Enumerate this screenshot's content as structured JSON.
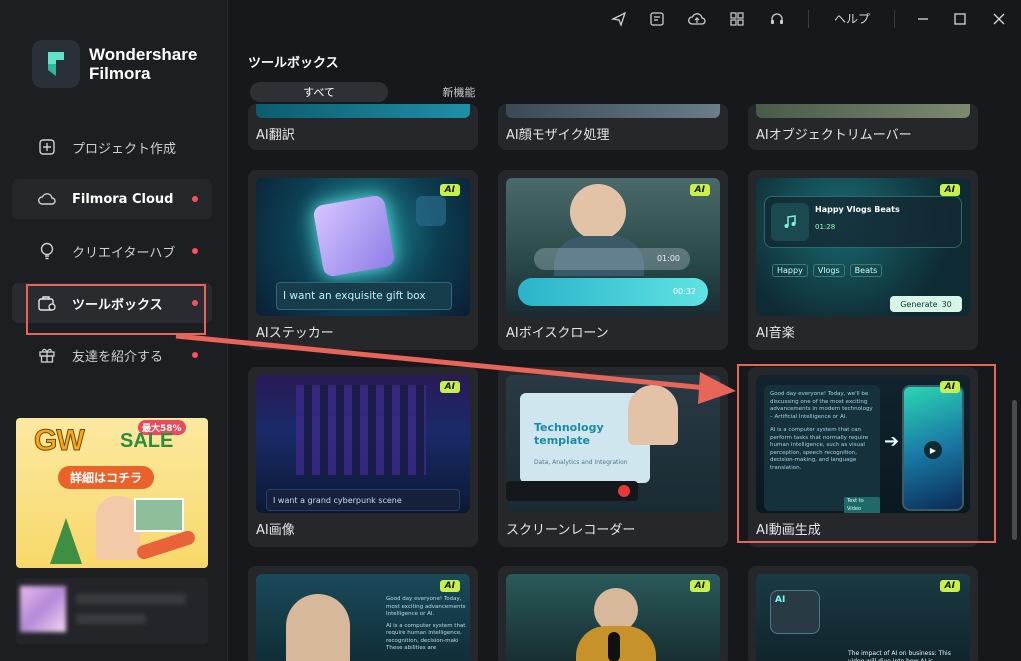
{
  "app": {
    "name_line1": "Wondershare",
    "name_line2": "Filmora"
  },
  "sidebar": {
    "items": [
      {
        "label": "プロジェクト作成",
        "icon": "new-project-icon"
      },
      {
        "label": "Filmora Cloud",
        "icon": "cloud-icon",
        "dot": true
      },
      {
        "label": "クリエイターハブ",
        "icon": "lightbulb-icon",
        "dot": true
      },
      {
        "label": "ツールボックス",
        "icon": "toolbox-icon",
        "dot": true
      },
      {
        "label": "友達を紹介する",
        "icon": "gift-icon",
        "dot": true
      }
    ],
    "banner": {
      "gw": "GW",
      "sale": "SALE",
      "discount": "最大58%",
      "cta": "詳細はコチラ"
    }
  },
  "topbar": {
    "icons": [
      "send-icon",
      "schedule-icon",
      "cloud-upload-icon",
      "grid-icon",
      "headset-icon"
    ],
    "help": "ヘルプ"
  },
  "main": {
    "title": "ツールボックス",
    "tabs": [
      {
        "label": "すべて"
      },
      {
        "label": "新機能"
      }
    ],
    "row0": [
      "AI翻訳",
      "AI顔モザイク処理",
      "AIオブジェクトリムーバー"
    ],
    "row1": [
      "AIステッカー",
      "AIボイスクローン",
      "AI音楽"
    ],
    "row2": [
      "AI画像",
      "スクリーンレコーダー",
      "AI動画生成"
    ],
    "thumbs": {
      "sticker_prompt": "I want an exquisite gift box",
      "voice_time1": "01:00",
      "voice_time2": "00:32",
      "music_title": "Happy Vlogs Beats",
      "music_time": "01:28",
      "music_tags": [
        "Happy",
        "Vlogs",
        "Beats"
      ],
      "music_button": "Generate",
      "music_count": "30",
      "image_prompt": "I want a grand cyberpunk scene",
      "recorder_title_1": "Technology",
      "recorder_title_2": "template",
      "recorder_sub": "Data, Analytics and Integration",
      "video_text_1": "Good day everyone! Today, we'll be discussing one of the most exciting advancements in modern technology – Artificial Intelligence or AI.",
      "video_text_2": "AI is a computer system that can perform tasks that normally require human intelligence, such as visual perception, speech recognition, decision-making, and language translation.",
      "video_button": "Text to Video",
      "row3_text_1": "Good day everyone! Today, most exciting advancements Intelligence or AI.",
      "row3_text_2": "AI is a computer system that require human intelligence, recognition, decision-maki These abilities are",
      "row3_ai_label": "AI",
      "row3_impact": "The impact of AI on business: This video will dive into how AI is transforming industries."
    },
    "ai_badge": "AI"
  }
}
